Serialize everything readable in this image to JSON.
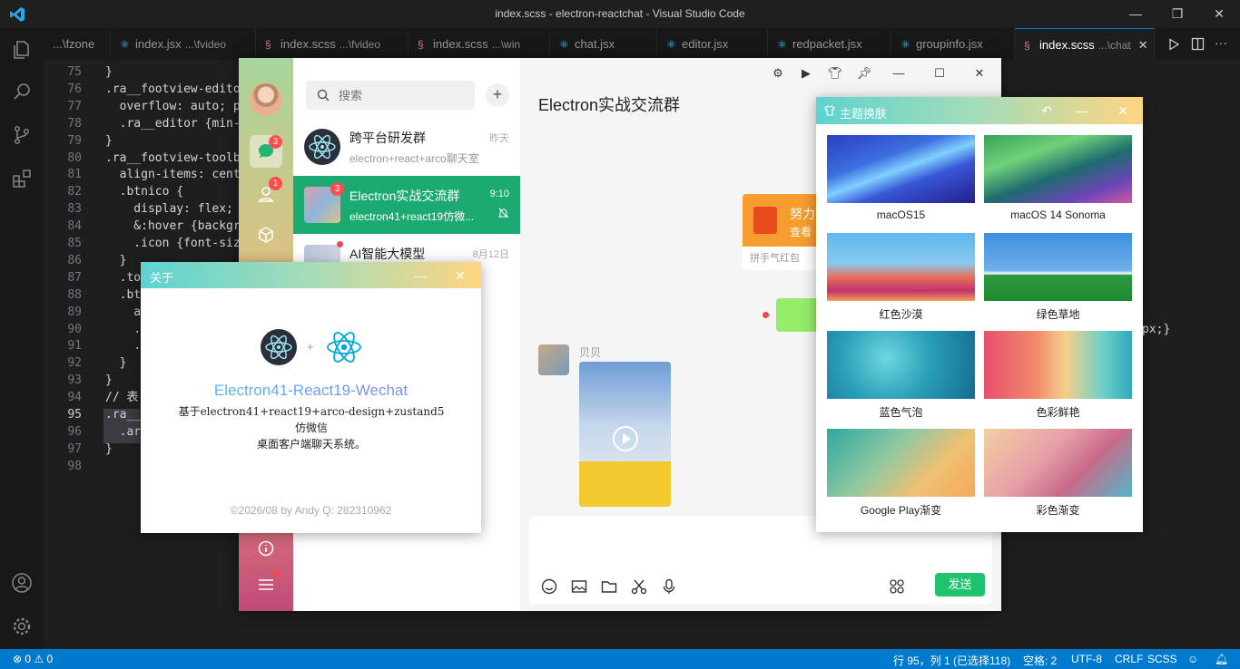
{
  "window": {
    "title": "index.scss - electron-reactchat - Visual Studio Code"
  },
  "tabs": [
    {
      "name": "...\\fzone",
      "dir": "",
      "icon": ""
    },
    {
      "name": "index.jsx",
      "dir": "...\\fvideo",
      "icon": "react"
    },
    {
      "name": "index.scss",
      "dir": "...\\fvideo",
      "icon": "sass"
    },
    {
      "name": "index.scss",
      "dir": "...\\win",
      "icon": "sass"
    },
    {
      "name": "chat.jsx",
      "dir": "",
      "icon": "react"
    },
    {
      "name": "editor.jsx",
      "dir": "",
      "icon": "react"
    },
    {
      "name": "redpacket.jsx",
      "dir": "",
      "icon": "react"
    },
    {
      "name": "groupinfo.jsx",
      "dir": "",
      "icon": "react"
    },
    {
      "name": "index.scss",
      "dir": "...\\chat",
      "icon": "sass",
      "active": true
    }
  ],
  "editor": {
    "lines": [
      {
        "num": "75",
        "text": "}"
      },
      {
        "num": "76",
        "text": ".ra__footview-edito"
      },
      {
        "num": "77",
        "text": "  overflow: auto; p"
      },
      {
        "num": "78",
        "text": "  .ra__editor {min-"
      },
      {
        "num": "79",
        "text": "}"
      },
      {
        "num": "80",
        "text": ".ra__footview-toolb"
      },
      {
        "num": "81",
        "text": "  align-items: cent"
      },
      {
        "num": "82",
        "text": "  .btnico {"
      },
      {
        "num": "83",
        "text": "    display: flex; "
      },
      {
        "num": "84",
        "text": "    &:hover {backgr"
      },
      {
        "num": "85",
        "text": "    .icon {font-siz"
      },
      {
        "num": "86",
        "text": "  }"
      },
      {
        "num": "87",
        "text": "  .to"
      },
      {
        "num": "88",
        "text": "  .bt"
      },
      {
        "num": "89",
        "text": "    a"
      },
      {
        "num": "90",
        "text": "    ."
      },
      {
        "num": "91",
        "text": "    ."
      },
      {
        "num": "92",
        "text": "  }"
      },
      {
        "num": "93",
        "text": "}"
      },
      {
        "num": "94",
        "text": "// 表"
      },
      {
        "num": "95",
        "text": ".ra__"
      },
      {
        "num": "96",
        "text": "  .ar"
      },
      {
        "num": "97",
        "text": "}"
      },
      {
        "num": "98",
        "text": ""
      }
    ],
    "right_fragment": "px;}"
  },
  "statusbar": {
    "errors": "0",
    "warnings": "0",
    "position": "行 95，列 1 (已选择118)",
    "spaces": "空格: 2",
    "encoding": "UTF-8",
    "eol": "CRLF",
    "language": "SCSS"
  },
  "chat": {
    "sidebar": {
      "chat_badge": "3",
      "contacts_badge": "1"
    },
    "search": {
      "placeholder": "搜索"
    },
    "conversations": [
      {
        "name": "跨平台研发群",
        "message": "electron+react+arco聊天室",
        "time": "昨天",
        "badge": ""
      },
      {
        "name": "Electron实战交流群",
        "message": "electron41+react19仿微...",
        "time": "9:10",
        "badge": "3",
        "active": true
      },
      {
        "name": "AI智能大模型",
        "message": "",
        "time": "8月12日",
        "badge": ""
      }
    ],
    "title": "Electron实战交流群",
    "redpacket": {
      "title": "努力",
      "subtitle": "查看",
      "footer": "拼手气红包"
    },
    "message_sender": "贝贝",
    "send_label": "发送"
  },
  "about": {
    "title": "关于",
    "app_name": "Electron41-React19-Wechat",
    "desc_line1": "基于electron41+react19+arco-design+zustand5仿微信",
    "desc_line2": "桌面客户端聊天系统。",
    "footer": "©2026/08 by Andy   Q: 282310962"
  },
  "theme": {
    "title": "主题换肤",
    "items": [
      {
        "label": "macOS15",
        "color": "#3b4fcf"
      },
      {
        "label": "macOS 14 Sonoma",
        "color": "#3aa35a"
      },
      {
        "label": "红色沙漠",
        "color": "#e85a4a"
      },
      {
        "label": "绿色草地",
        "color": "#2b9a3c"
      },
      {
        "label": "蓝色气泡",
        "color": "#2aa0b8"
      },
      {
        "label": "色彩鲜艳",
        "color": "#e8506e"
      },
      {
        "label": "Google Play渐变",
        "color": "#e0b060"
      },
      {
        "label": "彩色渐变",
        "color": "#c96a8a"
      }
    ]
  }
}
